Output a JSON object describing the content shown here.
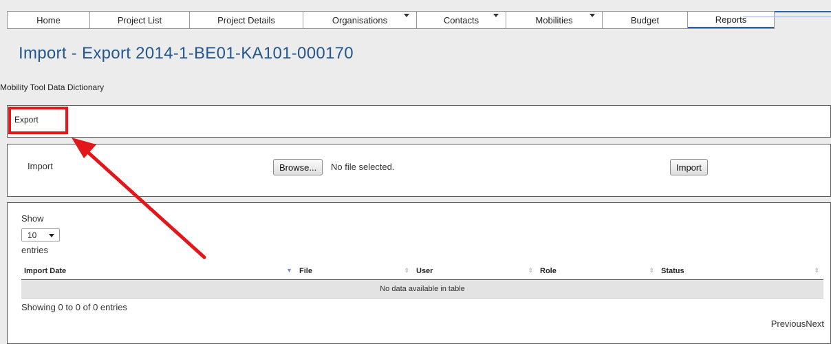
{
  "nav": {
    "items": [
      {
        "label": "Home",
        "has_dropdown": false
      },
      {
        "label": "Project List",
        "has_dropdown": false
      },
      {
        "label": "Project Details",
        "has_dropdown": false
      },
      {
        "label": "Organisations",
        "has_dropdown": true
      },
      {
        "label": "Contacts",
        "has_dropdown": true
      },
      {
        "label": "Mobilities",
        "has_dropdown": true
      },
      {
        "label": "Budget",
        "has_dropdown": false
      },
      {
        "label": "Reports",
        "has_dropdown": false
      }
    ]
  },
  "page": {
    "title": "Import - Export 2014-1-BE01-KA101-000170",
    "dictionary_link": "Mobility Tool Data Dictionary"
  },
  "export": {
    "label": "Export",
    "highlight_color": "#e3161a"
  },
  "import": {
    "label": "Import",
    "browse_label": "Browse...",
    "file_status": "No file selected.",
    "import_button": "Import"
  },
  "table": {
    "show_label": "Show",
    "page_length": "10",
    "entries_label": "entries",
    "columns": [
      "Import Date",
      "File",
      "User",
      "Role",
      "Status"
    ],
    "empty_message": "No data available in table",
    "info": "Showing 0 to 0 of 0 entries",
    "previous": "Previous",
    "next": "Next"
  },
  "colors": {
    "title": "#24578f",
    "annotation_arrow": "#e3161a"
  }
}
